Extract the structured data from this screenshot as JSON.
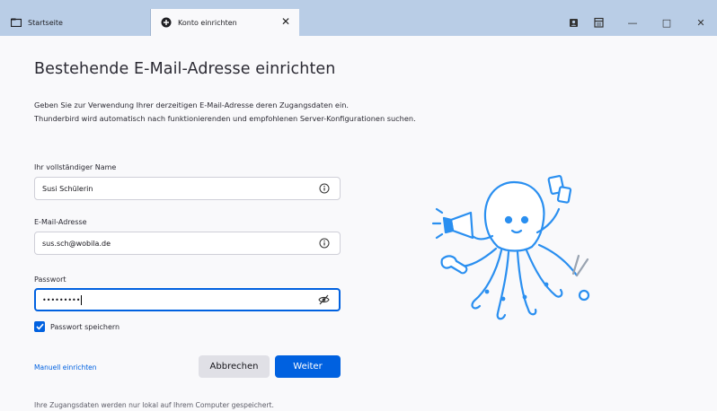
{
  "tabs": [
    {
      "label": "Startseite",
      "icon": "folder-icon"
    },
    {
      "label": "Konto einrichten",
      "icon": "add-circle-icon",
      "close": "✕"
    }
  ],
  "window_controls": {
    "icons": [
      "address-book-icon",
      "calendar-icon",
      "minimize-icon",
      "maximize-icon",
      "close-icon"
    ],
    "minimize": "—",
    "maximize": "□",
    "close": "✕"
  },
  "page": {
    "title": "Bestehende E-Mail-Adresse einrichten",
    "desc_line1": "Geben Sie zur Verwendung Ihrer derzeitigen E-Mail-Adresse deren Zugangsdaten ein.",
    "desc_line2": "Thunderbird wird automatisch nach funktionierenden und empfohlenen Server-Konfigurationen suchen."
  },
  "form": {
    "name": {
      "label": "Ihr vollständiger Name",
      "value": "Susi Schülerin",
      "icon": "info-icon"
    },
    "email": {
      "label": "E-Mail-Adresse",
      "value": "sus.sch@wobila.de",
      "icon": "info-icon"
    },
    "password": {
      "label": "Passwort",
      "value": "•••••••••",
      "icon": "eye-slash-icon"
    },
    "remember": {
      "label": "Passwort speichern",
      "checked": true
    }
  },
  "actions": {
    "manual": "Manuell einrichten",
    "cancel": "Abbrechen",
    "next": "Weiter"
  },
  "footnote": "Ihre Zugangsdaten werden nur lokal auf Ihrem Computer gespeichert.",
  "colors": {
    "accent": "#0061e0",
    "tabbar": "#b9cde6",
    "mascot": "#2a8ff0"
  }
}
